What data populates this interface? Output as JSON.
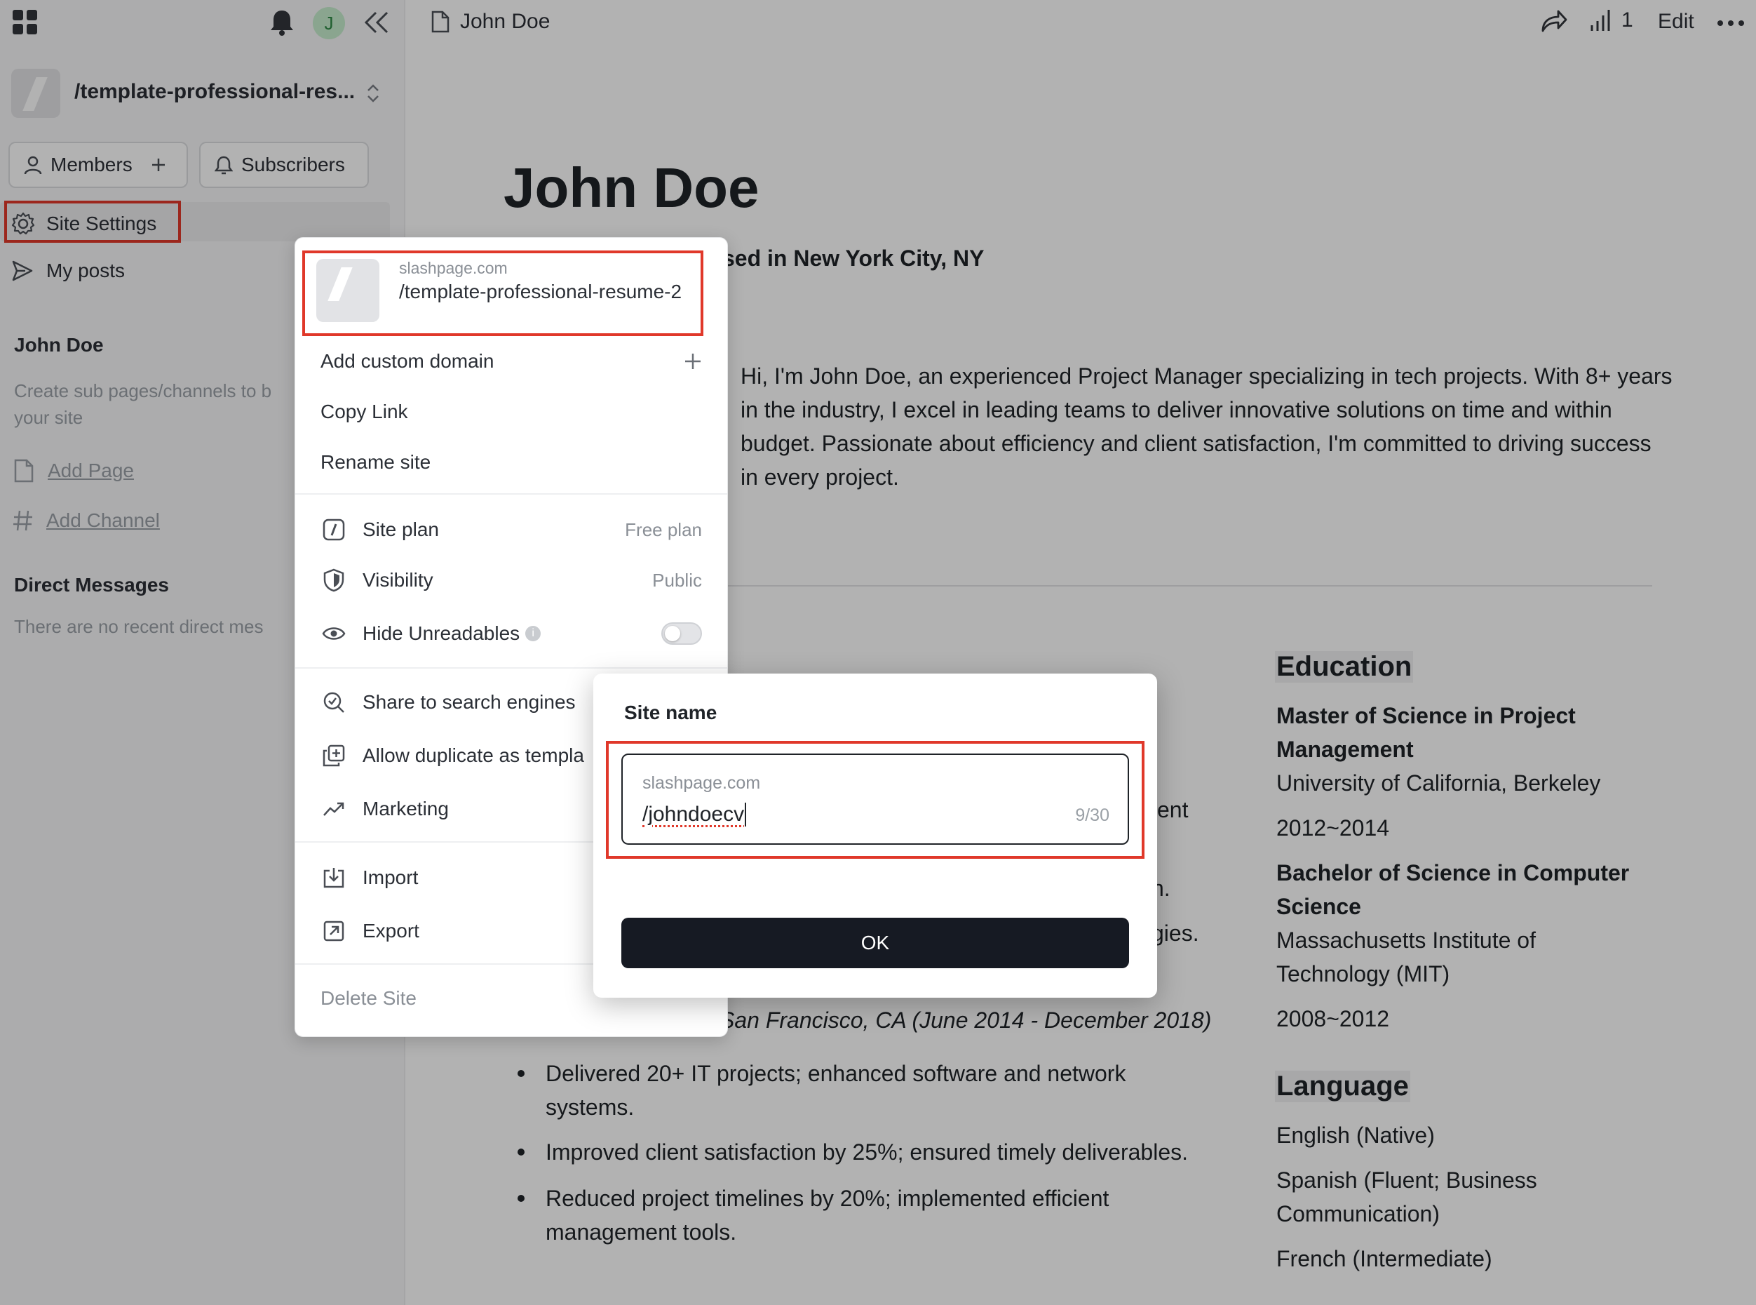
{
  "sidebar": {
    "avatar_letter": "J",
    "site_path": "/template-professional-res...",
    "members_label": "Members",
    "subscribers_label": "Subscribers",
    "site_settings_label": "Site Settings",
    "my_posts_label": "My posts",
    "section_title": "John Doe",
    "section_hint": "Create sub pages/channels to b your site",
    "add_page_label": "Add Page",
    "add_channel_label": "Add Channel",
    "dm_title": "Direct Messages",
    "dm_empty": "There are no recent direct mes"
  },
  "header": {
    "page_title": "John Doe",
    "stats_count": "1",
    "edit_label": "Edit"
  },
  "resume": {
    "name": "John Doe",
    "location_fragment": "sed in New York City, NY",
    "bio": "Hi, I'm John Doe, an experienced Project Manager specializing in tech projects. With 8+ years in the industry, I excel in leading teams to deliver innovative solutions on time and within budget. Passionate about efficiency and client satisfaction, I'm committed to driving success in every project.",
    "frag_ent": "ent",
    "frag_n": "n.",
    "frag_gies": "gies.",
    "job_fragment": "San Francisco, CA (June 2014 - December 2018)",
    "bullets": [
      "Delivered 20+ IT projects; enhanced software and network systems.",
      "Improved client satisfaction by 25%; ensured timely deliverables.",
      "Reduced project timelines by 20%; implemented efficient management tools."
    ],
    "education_title": "Education",
    "edu1_degree": "Master of Science in Project Management",
    "edu1_school": "University of California, Berkeley",
    "edu1_years": "2012~2014",
    "edu2_degree": "Bachelor of Science in Computer Science",
    "edu2_school": "Massachusetts Institute of Technology (MIT)",
    "edu2_years": "2008~2012",
    "language_title": "Language",
    "lang1": "English (Native)",
    "lang2": "Spanish (Fluent; Business Communication)",
    "lang3": "French (Intermediate)"
  },
  "menu": {
    "domain": "slashpage.com",
    "site_path": "/template-professional-resume-2",
    "add_custom_domain": "Add custom domain",
    "copy_link": "Copy Link",
    "rename_site": "Rename site",
    "site_plan": "Site plan",
    "site_plan_value": "Free plan",
    "visibility": "Visibility",
    "visibility_value": "Public",
    "hide_unreadables": "Hide Unreadables",
    "share_search": "Share to search engines",
    "allow_duplicate": "Allow duplicate as templa",
    "marketing": "Marketing",
    "import": "Import",
    "export": "Export",
    "delete_site": "Delete Site"
  },
  "dialog": {
    "title": "Site name",
    "domain_prefix": "slashpage.com",
    "input_value": "/johndoecv",
    "char_count": "9/30",
    "ok_label": "OK"
  },
  "colors": {
    "highlight": "#e0382a",
    "avatar_bg": "#c6eccd",
    "avatar_fg": "#2f8a45",
    "ok_button": "#161a23"
  }
}
